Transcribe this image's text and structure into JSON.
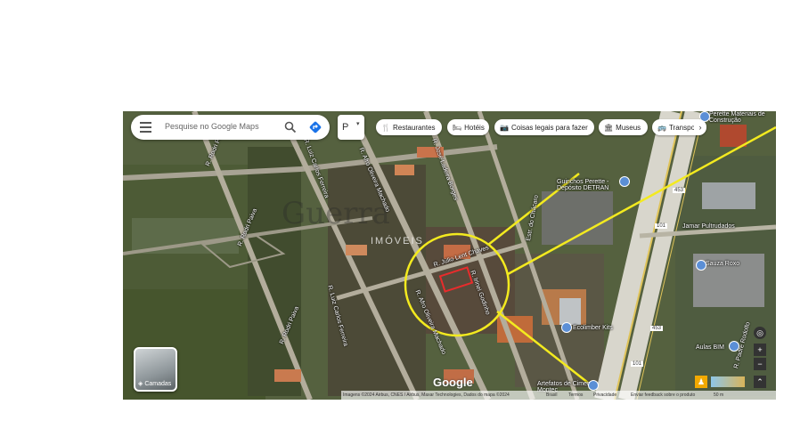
{
  "search": {
    "placeholder": "Pesquise no Google Maps"
  },
  "map_type_button": "P",
  "chips": [
    {
      "icon": "restaurant-icon",
      "glyph": "🍴",
      "label": "Restaurantes"
    },
    {
      "icon": "hotel-icon",
      "glyph": "🛏",
      "label": "Hotéis"
    },
    {
      "icon": "camera-icon",
      "glyph": "📷",
      "label": "Coisas legais para fazer"
    },
    {
      "icon": "museum-icon",
      "glyph": "🏛",
      "label": "Museus"
    },
    {
      "icon": "transit-icon",
      "glyph": "🚌",
      "label": "Transporte público"
    }
  ],
  "layers_label": "Camadas",
  "google_logo": "Google",
  "attribution": {
    "imagery": "Imagens ©2024 Airbus, CNES / Airbus, Maxar Technologies, Dados do mapa ©2024",
    "country": "Brasil",
    "terms": "Termos",
    "privacy": "Privacidade",
    "feedback": "Enviar feedback sobre o produto",
    "scale": "50 m"
  },
  "watermark": {
    "brand": "Guerra",
    "sub": "IMÓVEIS"
  },
  "street_labels": [
    "R. Rodri Paiva",
    "R. Rodri Paiva",
    "R. Rodri Paiva",
    "R. Luiz Carlos Ferreira",
    "R. Luiz Carlos Ferreira",
    "R. Afro Oliveira Machado",
    "R. Afro Oliveira Machado",
    "R. José Ladeira Borges",
    "R. Júlio Lent Chaves",
    "R. Irinei Godinho",
    "Estr. do Chácaro",
    "R. Padre Rodolfo"
  ],
  "places": [
    "Guinchos Perette - Depósito DETRAN",
    "Jamar Pultrudados",
    "Sauza Roxo",
    "Ecolimber Kits",
    "Aulas BIM",
    "Artefatos de Cimento Montec",
    "Perette Materiais de Construção"
  ],
  "road_shields": [
    "453",
    "101",
    "453",
    "101"
  ],
  "controls": {
    "zoom_in": "+",
    "zoom_out": "−"
  }
}
